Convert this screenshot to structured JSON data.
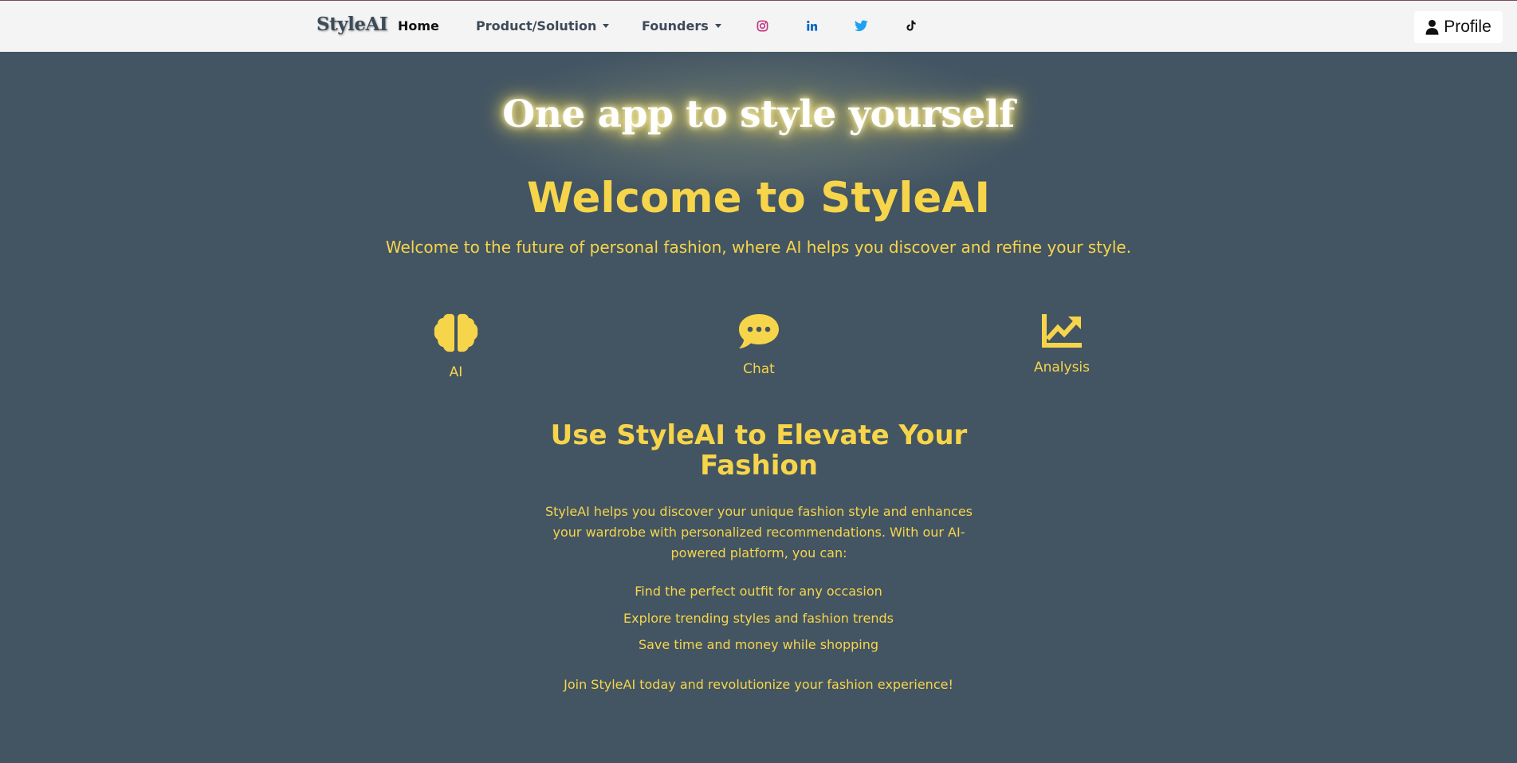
{
  "navbar": {
    "brand": "StyleAI",
    "home": "Home",
    "product": "Product/Solution",
    "founders": "Founders",
    "profile": "Profile",
    "social": [
      "instagram-icon",
      "linkedin-icon",
      "twitter-icon",
      "tiktok-icon"
    ]
  },
  "hero": {
    "tagline": "One app to style yourself",
    "welcome": "Welcome to StyleAI",
    "subtitle": "Welcome to the future of personal fashion, where AI helps you discover and refine your style."
  },
  "features": [
    {
      "label": "AI",
      "icon": "brain-icon"
    },
    {
      "label": "Chat",
      "icon": "chat-bubble-icon"
    },
    {
      "label": "Analysis",
      "icon": "chart-line-icon"
    }
  ],
  "section": {
    "title": "Use StyleAI to Elevate Your Fashion",
    "text": "StyleAI helps you discover your unique fashion style and enhances your wardrobe with personalized recommendations. With our AI-powered platform, you can:",
    "benefits": [
      "Find the perfect outfit for any occasion",
      "Explore trending styles and fashion trends",
      "Save time and money while shopping"
    ],
    "cta": "Join StyleAI today and revolutionize your fashion experience!"
  },
  "colors": {
    "background": "#435563",
    "accent": "#f7d54a",
    "navbar": "#f4f4f4",
    "instagram": "#c13584",
    "linkedin": "#0a66c2",
    "twitter": "#1da1f2"
  }
}
